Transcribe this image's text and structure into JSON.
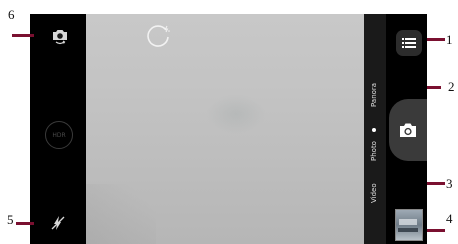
{
  "camera": {
    "left_bar": {
      "switch_camera_icon": "camera-switch",
      "hdr_label": "HDR",
      "flash_icon": "flash-off"
    },
    "viewfinder": {
      "panorama_indicator_icon": "panorama-ring"
    },
    "right_bar": {
      "menu_icon": "menu-list",
      "shutter_icon": "camera",
      "gallery_thumbnail": "gallery-preview",
      "modes": [
        "Panora",
        "Photo",
        "Video"
      ],
      "selected_mode": "Photo"
    }
  },
  "callouts": {
    "labels": [
      "1",
      "2",
      "3",
      "4",
      "5",
      "6"
    ]
  },
  "colors": {
    "callout": "#7a1030",
    "bar_background": "#000000",
    "mode_strip": "#1a1a1a",
    "viewfinder": "#c2c2c2"
  }
}
